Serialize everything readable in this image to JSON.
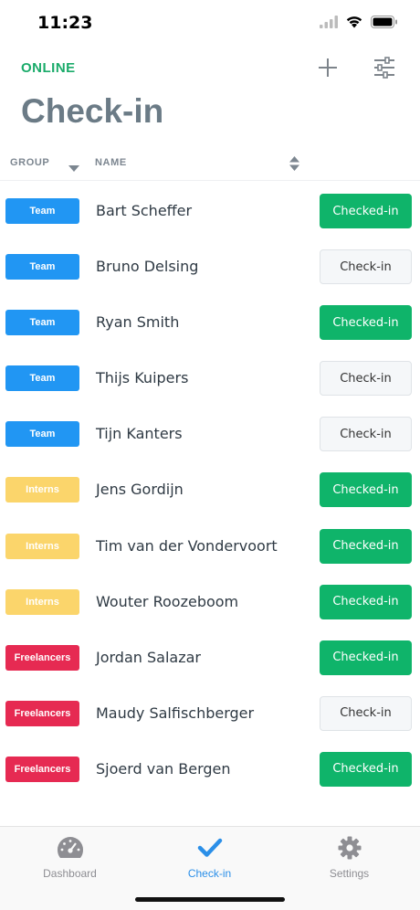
{
  "status_bar": {
    "time": "11:23",
    "icons": [
      "signal-icon",
      "wifi-icon",
      "battery-icon"
    ]
  },
  "header": {
    "status": "ONLINE",
    "add_icon": "plus-icon",
    "filter_icon": "sliders-icon"
  },
  "page": {
    "title": "Check-in"
  },
  "columns": {
    "group": "GROUP",
    "name": "NAME"
  },
  "colors": {
    "online": "#1aab6a",
    "team": "#2196f3",
    "interns": "#fbd56b",
    "freelancers": "#e62a52",
    "checked": "#0fb46a",
    "active_tab": "#2b8fe8"
  },
  "rows": [
    {
      "group": "Team",
      "group_type": "team",
      "name": "Bart Scheffer",
      "action": "Checked-in",
      "checked": true
    },
    {
      "group": "Team",
      "group_type": "team",
      "name": "Bruno Delsing",
      "action": "Check-in",
      "checked": false
    },
    {
      "group": "Team",
      "group_type": "team",
      "name": "Ryan Smith",
      "action": "Checked-in",
      "checked": true
    },
    {
      "group": "Team",
      "group_type": "team",
      "name": "Thijs Kuipers",
      "action": "Check-in",
      "checked": false
    },
    {
      "group": "Team",
      "group_type": "team",
      "name": "Tijn Kanters",
      "action": "Check-in",
      "checked": false
    },
    {
      "group": "Interns",
      "group_type": "interns",
      "name": "Jens Gordijn",
      "action": "Checked-in",
      "checked": true
    },
    {
      "group": "Interns",
      "group_type": "interns",
      "name": "Tim van der Vondervoort",
      "action": "Checked-in",
      "checked": true
    },
    {
      "group": "Interns",
      "group_type": "interns",
      "name": "Wouter Roozeboom",
      "action": "Checked-in",
      "checked": true
    },
    {
      "group": "Freelancers",
      "group_type": "freelancers",
      "name": "Jordan Salazar",
      "action": "Checked-in",
      "checked": true
    },
    {
      "group": "Freelancers",
      "group_type": "freelancers",
      "name": "Maudy Salfischberger",
      "action": "Check-in",
      "checked": false
    },
    {
      "group": "Freelancers",
      "group_type": "freelancers",
      "name": "Sjoerd van Bergen",
      "action": "Checked-in",
      "checked": true
    }
  ],
  "tabs": [
    {
      "label": "Dashboard",
      "icon": "gauge-icon",
      "active": false
    },
    {
      "label": "Check-in",
      "icon": "checkmark-icon",
      "active": true
    },
    {
      "label": "Settings",
      "icon": "gear-icon",
      "active": false
    }
  ]
}
